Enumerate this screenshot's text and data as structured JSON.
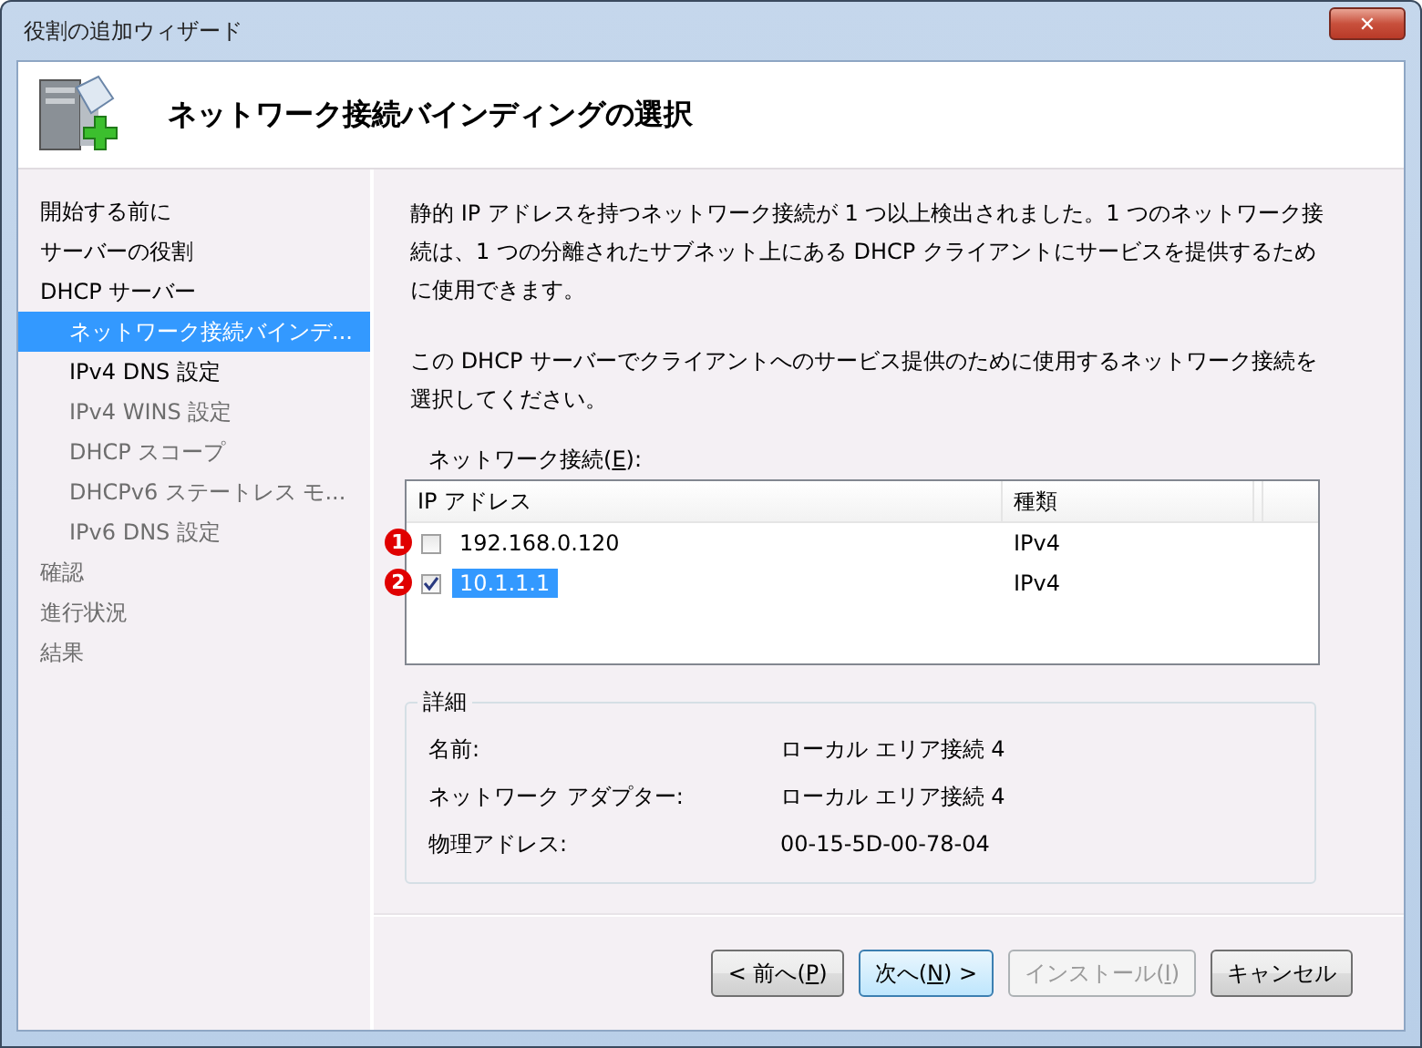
{
  "window": {
    "title": "役割の追加ウィザード",
    "close_glyph": "✕"
  },
  "header": {
    "title": "ネットワーク接続バインディングの選択"
  },
  "sidebar": {
    "items": [
      {
        "label": "開始する前に",
        "selected": false,
        "disabled": false
      },
      {
        "label": "サーバーの役割",
        "selected": false,
        "disabled": false
      },
      {
        "label": "DHCP サーバー",
        "selected": false,
        "disabled": false,
        "children": [
          {
            "label": "ネットワーク接続バインデ...",
            "selected": true,
            "disabled": false
          },
          {
            "label": "IPv4 DNS 設定",
            "selected": false,
            "disabled": false
          },
          {
            "label": "IPv4 WINS 設定",
            "selected": false,
            "disabled": true
          },
          {
            "label": "DHCP スコープ",
            "selected": false,
            "disabled": true
          },
          {
            "label": "DHCPv6 ステートレス モ...",
            "selected": false,
            "disabled": true
          },
          {
            "label": "IPv6 DNS 設定",
            "selected": false,
            "disabled": true
          }
        ]
      },
      {
        "label": "確認",
        "selected": false,
        "disabled": true
      },
      {
        "label": "進行状況",
        "selected": false,
        "disabled": true
      },
      {
        "label": "結果",
        "selected": false,
        "disabled": true
      }
    ]
  },
  "content": {
    "paragraphs": [
      "静的 IP アドレスを持つネットワーク接続が 1 つ以上検出されました。1 つのネットワーク接続は、1 つの分離されたサブネット上にある DHCP クライアントにサービスを提供するために使用できます。",
      "この DHCP サーバーでクライアントへのサービス提供のために使用するネットワーク接続を選択してください。"
    ],
    "list_label": {
      "pre": "ネットワーク接続(",
      "key": "E",
      "post": "):"
    },
    "table": {
      "columns": [
        "IP アドレス",
        "種類"
      ],
      "rows": [
        {
          "marker": "1",
          "ip": "192.168.0.120",
          "type": "IPv4",
          "checked": false,
          "selected": false
        },
        {
          "marker": "2",
          "ip": "10.1.1.1",
          "type": "IPv4",
          "checked": true,
          "selected": true
        }
      ]
    },
    "details": {
      "title": "詳細",
      "rows": [
        {
          "label": "名前:",
          "value": "ローカル エリア接続 4"
        },
        {
          "label": "ネットワーク アダプター:",
          "value": "ローカル エリア接続 4"
        },
        {
          "label": "物理アドレス:",
          "value": "00-15-5D-00-78-04"
        }
      ]
    }
  },
  "buttons": [
    {
      "pre": "< 前へ(",
      "key": "P",
      "post": ")",
      "disabled": false,
      "default": false
    },
    {
      "pre": "次へ(",
      "key": "N",
      "post": ") >",
      "disabled": false,
      "default": true
    },
    {
      "pre": "インストール(",
      "key": "I",
      "post": ")",
      "disabled": true,
      "default": false
    },
    {
      "post": "キャンセル",
      "disabled": false,
      "default": false
    }
  ]
}
